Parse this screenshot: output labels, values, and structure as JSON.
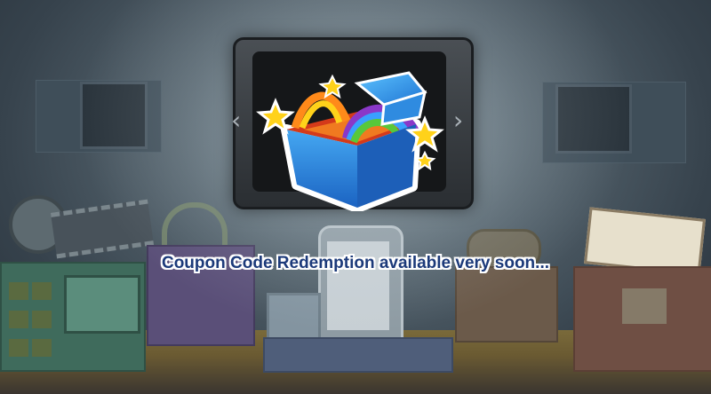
{
  "caption": "Coupon Code Redemption available very soon...",
  "nav": {
    "prev_glyph": "‹",
    "next_glyph": "›"
  },
  "icons": {
    "gift": "gift-box-icon",
    "film": "film-reel-icon",
    "headphones": "headphones-icon",
    "phone": "smartphone-icon",
    "gamepad": "gamepad-icon",
    "book": "open-book-icon"
  },
  "colors": {
    "caption_text": "#1c3a7a",
    "caption_outline": "#ffffff",
    "box_blue": "#2a86d8",
    "star_yellow": "#ffd21a"
  }
}
